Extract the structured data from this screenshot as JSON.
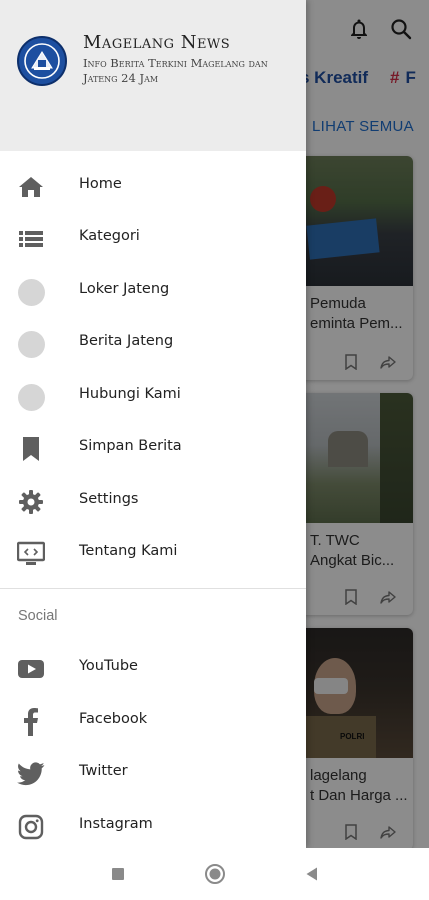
{
  "app": {
    "title": "Magelang News",
    "subtitle": "Info Berita Terkini Magelang dan Jateng 24 Jam"
  },
  "background": {
    "tabs": [
      "s Kreatif",
      "F"
    ],
    "tab_hash": "#",
    "lihat_semua": "LIHAT SEMUA",
    "cards": [
      {
        "title_line1": "Pemuda",
        "title_line2": "eminta Pem..."
      },
      {
        "title_line1": "T. TWC",
        "title_line2": "Angkat Bic..."
      },
      {
        "title_line1": "lagelang",
        "title_line2": "t Dan Harga ..."
      }
    ],
    "card3_badge": "POLRI"
  },
  "drawer": {
    "menu": [
      {
        "label": "Home",
        "icon": "home-icon"
      },
      {
        "label": "Kategori",
        "icon": "list-icon"
      },
      {
        "label": "Loker Jateng",
        "icon": "placeholder-circle-icon"
      },
      {
        "label": "Berita Jateng",
        "icon": "placeholder-circle-icon"
      },
      {
        "label": "Hubungi Kami",
        "icon": "placeholder-circle-icon"
      },
      {
        "label": "Simpan Berita",
        "icon": "bookmark-icon"
      },
      {
        "label": "Settings",
        "icon": "gear-icon"
      },
      {
        "label": "Tentang Kami",
        "icon": "monitor-icon"
      }
    ],
    "social_label": "Social",
    "social": [
      {
        "label": "YouTube",
        "icon": "youtube-icon"
      },
      {
        "label": "Facebook",
        "icon": "facebook-icon"
      },
      {
        "label": "Twitter",
        "icon": "twitter-icon"
      },
      {
        "label": "Instagram",
        "icon": "instagram-icon"
      }
    ]
  },
  "colors": {
    "accent_blue": "#1f4fa3",
    "hash_red": "#d9304a",
    "drawer_header_bg": "#ececec",
    "icon_gray": "#5f5f5f"
  }
}
